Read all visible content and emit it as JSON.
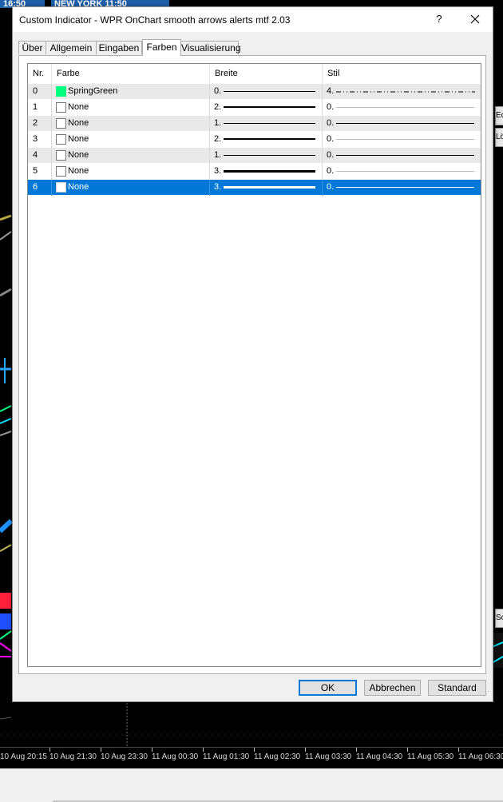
{
  "window": {
    "title": "Custom Indicator - WPR OnChart smooth arrows alerts mtf 2.03",
    "help_label": "?"
  },
  "tabs": [
    {
      "label": "Über"
    },
    {
      "label": "Allgemein"
    },
    {
      "label": "Eingaben"
    },
    {
      "label": "Farben"
    },
    {
      "label": "Visualisierung"
    }
  ],
  "table": {
    "columns": [
      "Nr.",
      "Farbe",
      "Breite",
      "Stil"
    ],
    "rows": [
      {
        "nr": "0",
        "color_name": "SpringGreen",
        "color": "#00ff7f",
        "width": "0.",
        "style": "4."
      },
      {
        "nr": "1",
        "color_name": "None",
        "color": "#ffffff",
        "width": "2.",
        "style": "0."
      },
      {
        "nr": "2",
        "color_name": "None",
        "color": "#ffffff",
        "width": "1.",
        "style": "0."
      },
      {
        "nr": "3",
        "color_name": "None",
        "color": "#ffffff",
        "width": "2.",
        "style": "0."
      },
      {
        "nr": "4",
        "color_name": "None",
        "color": "#ffffff",
        "width": "1.",
        "style": "0."
      },
      {
        "nr": "5",
        "color_name": "None",
        "color": "#ffffff",
        "width": "3.",
        "style": "0."
      },
      {
        "nr": "6",
        "color_name": "None",
        "color": "#ffffff",
        "width": "3.",
        "style": "0.",
        "selected": true
      }
    ]
  },
  "buttons": {
    "ok": "OK",
    "cancel": "Abbrechen",
    "standard": "Standard"
  },
  "background": {
    "top_chip_1": "16:50",
    "top_chip_2": "NEW YORK  11:50",
    "side_tab_1": "Ec",
    "side_tab_2": "Lö",
    "side_tab_3": "Sc",
    "time_axis": [
      "10 Aug 20:15",
      "10 Aug 21:30",
      "10 Aug 23:30",
      "11 Aug 00:30",
      "11 Aug 01:30",
      "11 Aug 02:30",
      "11 Aug 03:30",
      "11 Aug 04:30",
      "11 Aug 05:30",
      "11 Aug 06:30"
    ]
  },
  "colors": {
    "selection": "#0078d7",
    "spring_green": "#00ff7f",
    "chart_background": "#000000"
  }
}
